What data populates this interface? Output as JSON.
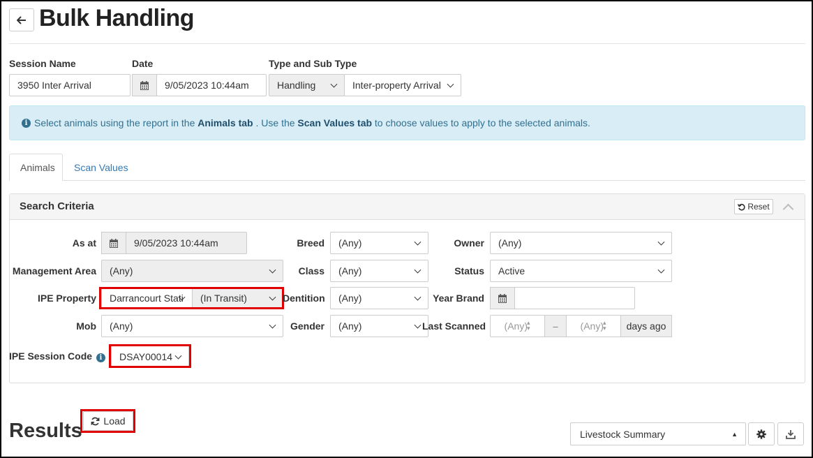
{
  "page": {
    "title": "Bulk Handling",
    "back_icon": "arrow-left-icon"
  },
  "session": {
    "name_label": "Session Name",
    "name_value": "3950 Inter Arrival",
    "date_label": "Date",
    "date_value": "9/05/2023 10:44am",
    "type_label": "Type and Sub Type",
    "type_value": "Handling",
    "subtype_value": "Inter-property Arrival"
  },
  "alert": {
    "part1": "Select animals using the report in the",
    "animals_tab": "Animals tab",
    "part2": ". Use the",
    "scan_values_tab": "Scan Values tab",
    "part3": "to choose values to apply to the selected animals."
  },
  "tabs": [
    {
      "label": "Animals",
      "active": true
    },
    {
      "label": "Scan Values",
      "active": false
    }
  ],
  "search": {
    "title": "Search Criteria",
    "reset_label": "Reset",
    "as_at_label": "As at",
    "as_at_value": "9/05/2023 10:44am",
    "management_area_label": "Management Area",
    "management_area_value": "(Any)",
    "ipe_property_label": "IPE Property",
    "ipe_property_value": "Darrancourt Stati",
    "ipe_property_status": "(In Transit)",
    "mob_label": "Mob",
    "mob_value": "(Any)",
    "ipe_session_code_label": "IPE Session Code",
    "ipe_session_code_value": "DSAY00014",
    "breed_label": "Breed",
    "breed_value": "(Any)",
    "class_label": "Class",
    "class_value": "(Any)",
    "dentition_label": "Dentition",
    "dentition_value": "(Any)",
    "gender_label": "Gender",
    "gender_value": "(Any)",
    "owner_label": "Owner",
    "owner_value": "(Any)",
    "status_label": "Status",
    "status_value": "Active",
    "year_brand_label": "Year Brand",
    "year_brand_value": "",
    "last_scanned_label": "Last Scanned",
    "last_scanned_from_placeholder": "(Any)",
    "last_scanned_to_placeholder": "(Any)",
    "last_scanned_sep": "–",
    "last_scanned_unit": "days ago"
  },
  "results": {
    "title": "Results",
    "load_label": "Load",
    "summary_select": "Livestock Summary",
    "settings_icon": "gear-icon",
    "download_icon": "download-icon"
  },
  "colors": {
    "alert_bg": "#d9edf7",
    "alert_text": "#31708f",
    "link": "#337ab7",
    "highlight": "#e00000"
  }
}
